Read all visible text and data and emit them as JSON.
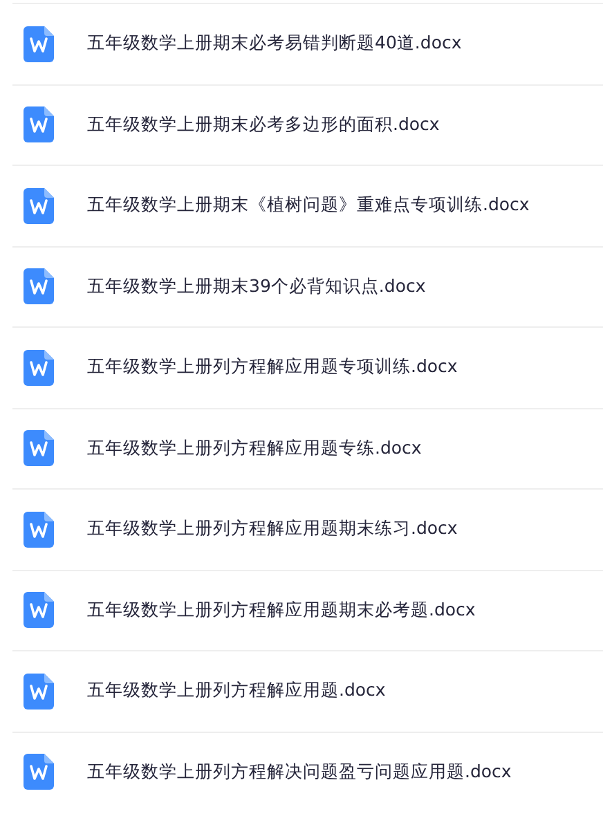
{
  "files": [
    {
      "name": "五年级数学上册期末必考易错判断题40道.docx",
      "kind": "word"
    },
    {
      "name": "五年级数学上册期末必考多边形的面积.docx",
      "kind": "word"
    },
    {
      "name": "五年级数学上册期末《植树问题》重难点专项训练.docx",
      "kind": "word"
    },
    {
      "name": "五年级数学上册期末39个必背知识点.docx",
      "kind": "word"
    },
    {
      "name": "五年级数学上册列方程解应用题专项训练.docx",
      "kind": "word"
    },
    {
      "name": "五年级数学上册列方程解应用题专练.docx",
      "kind": "word"
    },
    {
      "name": "五年级数学上册列方程解应用题期末练习.docx",
      "kind": "word"
    },
    {
      "name": "五年级数学上册列方程解应用题期末必考题.docx",
      "kind": "word"
    },
    {
      "name": "五年级数学上册列方程解应用题.docx",
      "kind": "word"
    },
    {
      "name": "五年级数学上册列方程解决问题盈亏问题应用题.docx",
      "kind": "word"
    }
  ]
}
